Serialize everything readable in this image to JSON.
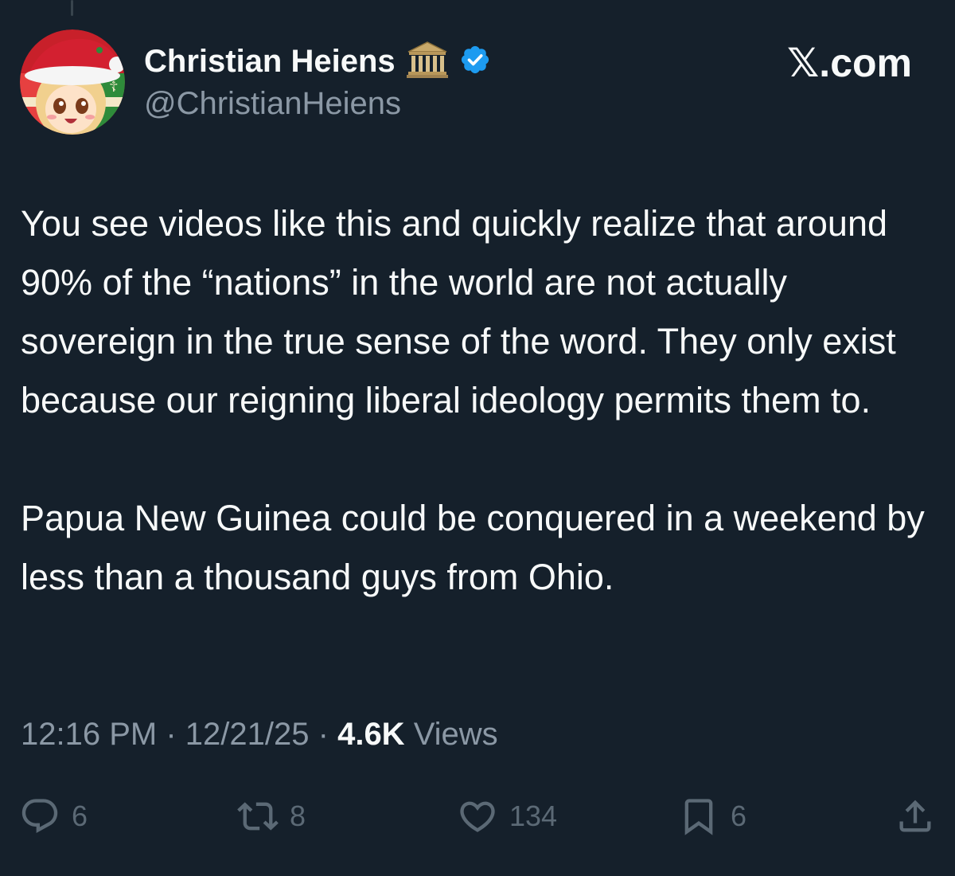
{
  "author": {
    "display_name": "Christian Heiens",
    "name_emoji": "classical-building-emoji",
    "verified_badge": "verified-badge-icon",
    "handle": "@ChristianHeiens",
    "avatar": "christmas-anime-avatar"
  },
  "brand": {
    "label": "𝕏.com"
  },
  "tweet": {
    "paragraphs": [
      "You see videos like this and quickly realize that around 90% of the “nations” in the world are not actually sovereign in the true sense of the word. They only exist because our reigning liberal ideology permits them to.",
      "Papua New Guinea could be conquered in a weekend by less than a thousand guys from Ohio."
    ],
    "time": "12:16 PM",
    "separator": "·",
    "date": "12/21/25",
    "views_count": "4.6K",
    "views_label": "Views"
  },
  "actions": {
    "reply": {
      "icon": "reply-icon",
      "count": "6"
    },
    "repost": {
      "icon": "repost-icon",
      "count": "8"
    },
    "like": {
      "icon": "heart-icon",
      "count": "134"
    },
    "bookmark": {
      "icon": "bookmark-icon",
      "count": "6"
    },
    "share": {
      "icon": "share-icon"
    }
  },
  "colors": {
    "background": "#15202b",
    "primary_text": "#f7f9f9",
    "secondary_text": "#8b98a5",
    "action_icon": "#5b6975",
    "verified_blue": "#1d9bf0"
  }
}
